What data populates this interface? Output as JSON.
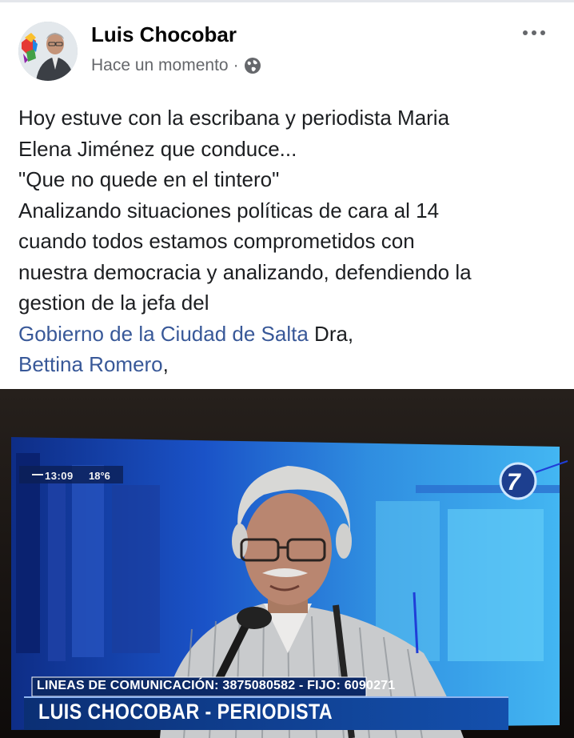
{
  "post": {
    "author": "Luis Chocobar",
    "timestamp": "Hace un momento",
    "separator": "·",
    "audience_icon": "globe-icon",
    "more_icon": "more-options-icon",
    "text_lines": [
      "Hoy estuve con la escribana y periodista Maria",
      "Elena Jiménez que conduce...",
      "\"Que no quede en el tintero\"",
      "Analizando situaciones políticas de cara al 14",
      "cuando todos estamos comprometidos con",
      "nuestra democracia y analizando, defendiendo la",
      "gestion de la jefa del"
    ],
    "link_1": "Gobierno de la Ciudad de Salta",
    "after_link_1": " Dra,",
    "link_2": "Bettina Romero",
    "after_link_2": ",",
    "link_color": "#385898"
  },
  "photo": {
    "clock": "13:09",
    "temperature": "18°6",
    "channel_number": "7",
    "lower_third_line_1": "LINEAS DE COMUNICACIÓN: 3875080582 - FIJO: 6090271",
    "lower_third_line_2": "LUIS CHOCOBAR - PERIODISTA",
    "lower_third_color": "#0f3f86"
  }
}
